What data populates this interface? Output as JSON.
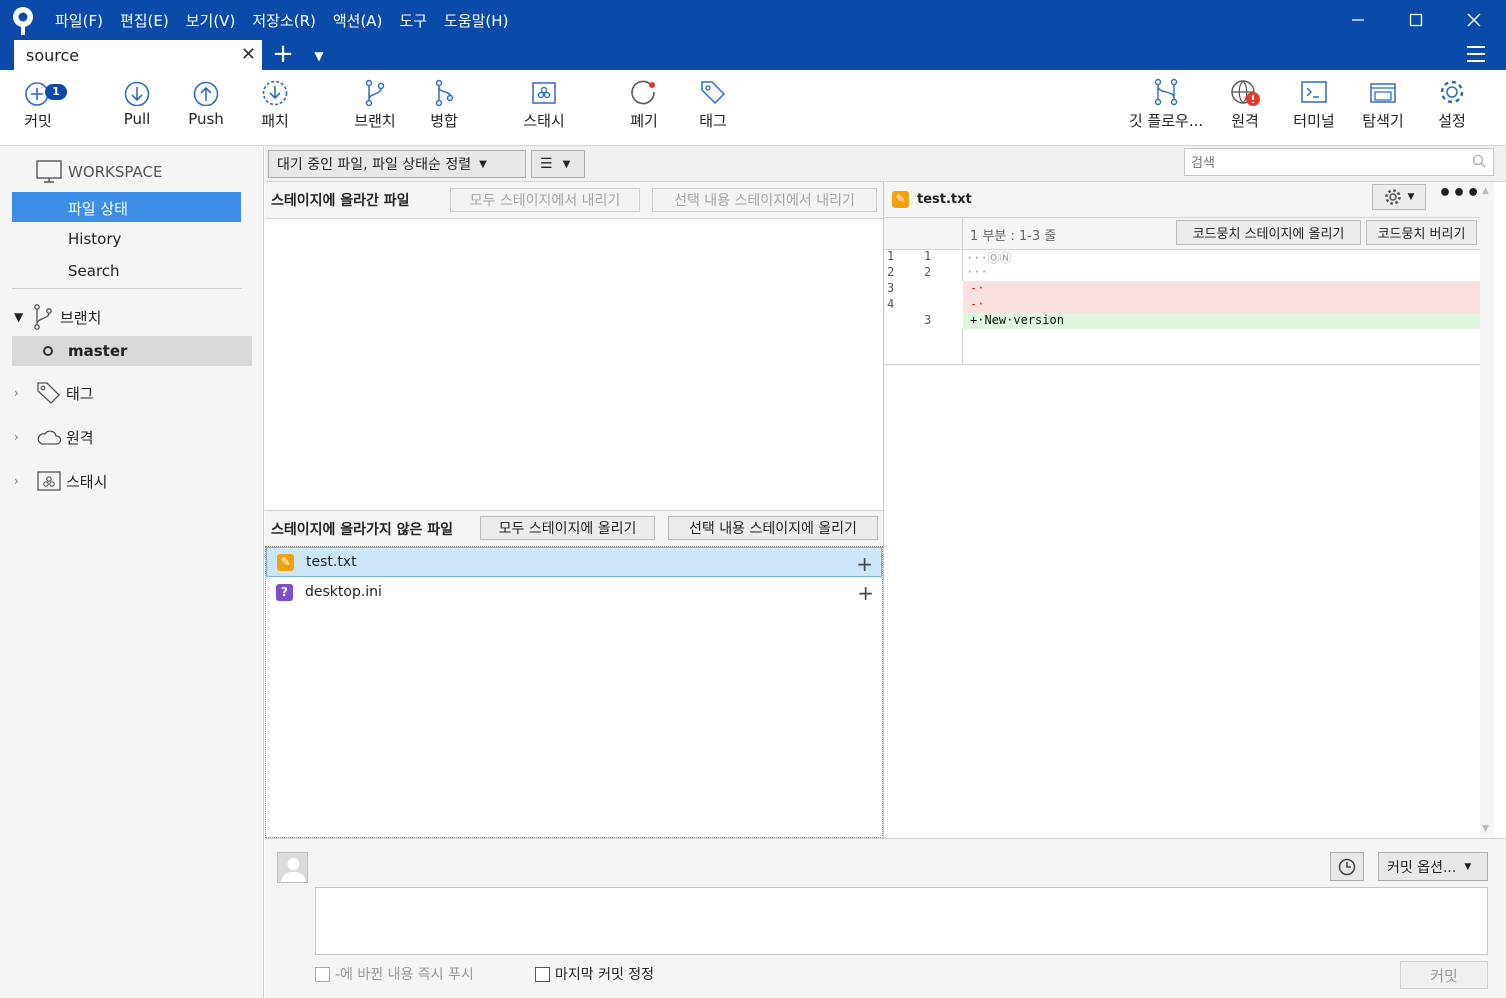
{
  "app": {
    "menus": [
      "파일(F)",
      "편집(E)",
      "보기(V)",
      "저장소(R)",
      "액션(A)",
      "도구",
      "도움말(H)"
    ],
    "tab_title": "source",
    "brand_color": "#0a4aa8"
  },
  "toolbar": {
    "commit": {
      "label": "커밋",
      "badge": "1"
    },
    "pull": "Pull",
    "push": "Push",
    "fetch": "패치",
    "branch": "브랜치",
    "merge": "병합",
    "stash": "스태시",
    "discard": "폐기",
    "tag": "태그",
    "gitflow": "깃 플로우...",
    "remote": "원격",
    "terminal": "터미널",
    "explorer": "탐색기",
    "settings": "설정"
  },
  "sidebar": {
    "workspace": "WORKSPACE",
    "items": [
      "파일 상태",
      "History",
      "Search"
    ],
    "branches": "브랜치",
    "current_branch": "master",
    "tags": "태그",
    "remotes": "원격",
    "stashes": "스태시"
  },
  "filter": {
    "sort": "대기 중인 파일, 파일 상태순 정렬",
    "view": "☰",
    "search_placeholder": "검색"
  },
  "staged": {
    "title": "스테이지에 올라간 파일",
    "unstage_all": "모두 스테이지에서 내리기",
    "unstage_selected": "선택 내용 스테이지에서 내리기"
  },
  "unstaged": {
    "title": "스테이지에 올라가지 않은 파일",
    "stage_all": "모두 스테이지에 올리기",
    "stage_selected": "선택 내용 스테이지에 올리기",
    "files": [
      {
        "name": "test.txt",
        "status": "modified"
      },
      {
        "name": "desktop.ini",
        "status": "untracked"
      }
    ]
  },
  "diff": {
    "file": "test.txt",
    "hunk_header": "1 부분 : 1-3 줄",
    "stage_hunk": "코드뭉치 스테이지에 올리기",
    "discard_hunk": "코드뭉치 버리기",
    "lines": [
      {
        "old": "1",
        "new": "1",
        "text": "···ⓄⓃ",
        "type": "context"
      },
      {
        "old": "2",
        "new": "2",
        "text": "···",
        "type": "context"
      },
      {
        "old": "3",
        "new": "",
        "text": "-·",
        "type": "removed"
      },
      {
        "old": "4",
        "new": "",
        "text": "-·",
        "type": "removed"
      },
      {
        "old": "",
        "new": "3",
        "text": "+·New·version",
        "type": "added"
      }
    ]
  },
  "commit": {
    "options": "커밋 옵션...",
    "push_immediately": "-에 바뀐 내용 즉시 푸시",
    "amend": "마지막 커밋 정정",
    "submit": "커밋"
  }
}
